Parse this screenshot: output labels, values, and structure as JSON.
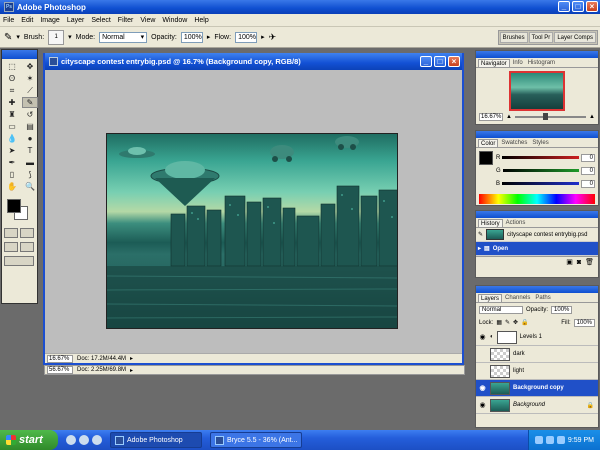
{
  "app": {
    "title": "Adobe Photoshop"
  },
  "menu": [
    "File",
    "Edit",
    "Image",
    "Layer",
    "Select",
    "Filter",
    "View",
    "Window",
    "Help"
  ],
  "options": {
    "brush_label": "Brush:",
    "brush_size": "1",
    "mode_label": "Mode:",
    "mode_value": "Normal",
    "opacity_label": "Opacity:",
    "opacity_value": "100%",
    "flow_label": "Flow:",
    "flow_value": "100%",
    "palette_well": [
      "Brushes",
      "Tool Pr",
      "Layer Comps"
    ]
  },
  "document": {
    "title": "cityscape contest entrybig.psd @ 16.7% (Background copy, RGB/8)",
    "zoom": "16.67%",
    "doc_size": "Doc: 17.2M/44.4M"
  },
  "background_window": {
    "zoom": "56.67%",
    "doc_size": "Doc: 2.25M/69.8M"
  },
  "navigator": {
    "tabs": [
      "Navigator",
      "Info",
      "Histogram"
    ],
    "zoom": "16.67%"
  },
  "color": {
    "tabs": [
      "Color",
      "Swatches",
      "Styles"
    ],
    "channels": [
      {
        "label": "R",
        "value": "0",
        "color": "#cc1f1f"
      },
      {
        "label": "G",
        "value": "0",
        "color": "#1f9a2a"
      },
      {
        "label": "B",
        "value": "0",
        "color": "#1f2fcc"
      }
    ]
  },
  "history": {
    "tabs": [
      "History",
      "Actions"
    ],
    "items": [
      {
        "label": "cityscape contest entrybig.psd"
      },
      {
        "label": "Open"
      }
    ]
  },
  "layers": {
    "tabs": [
      "Layers",
      "Channels",
      "Paths"
    ],
    "blend_mode": "Normal",
    "opacity_label": "Opacity:",
    "opacity_value": "100%",
    "lock_label": "Lock:",
    "fill_label": "Fill:",
    "fill_value": "100%",
    "items": [
      {
        "name": "Levels 1"
      },
      {
        "name": "dark"
      },
      {
        "name": "light"
      },
      {
        "name": "Background copy"
      },
      {
        "name": "Background"
      }
    ]
  },
  "taskbar": {
    "start": "start",
    "tasks": [
      "Adobe Photoshop",
      "Bryce 5.5 - 36% (Ant..."
    ],
    "clock": "9:59 PM"
  }
}
